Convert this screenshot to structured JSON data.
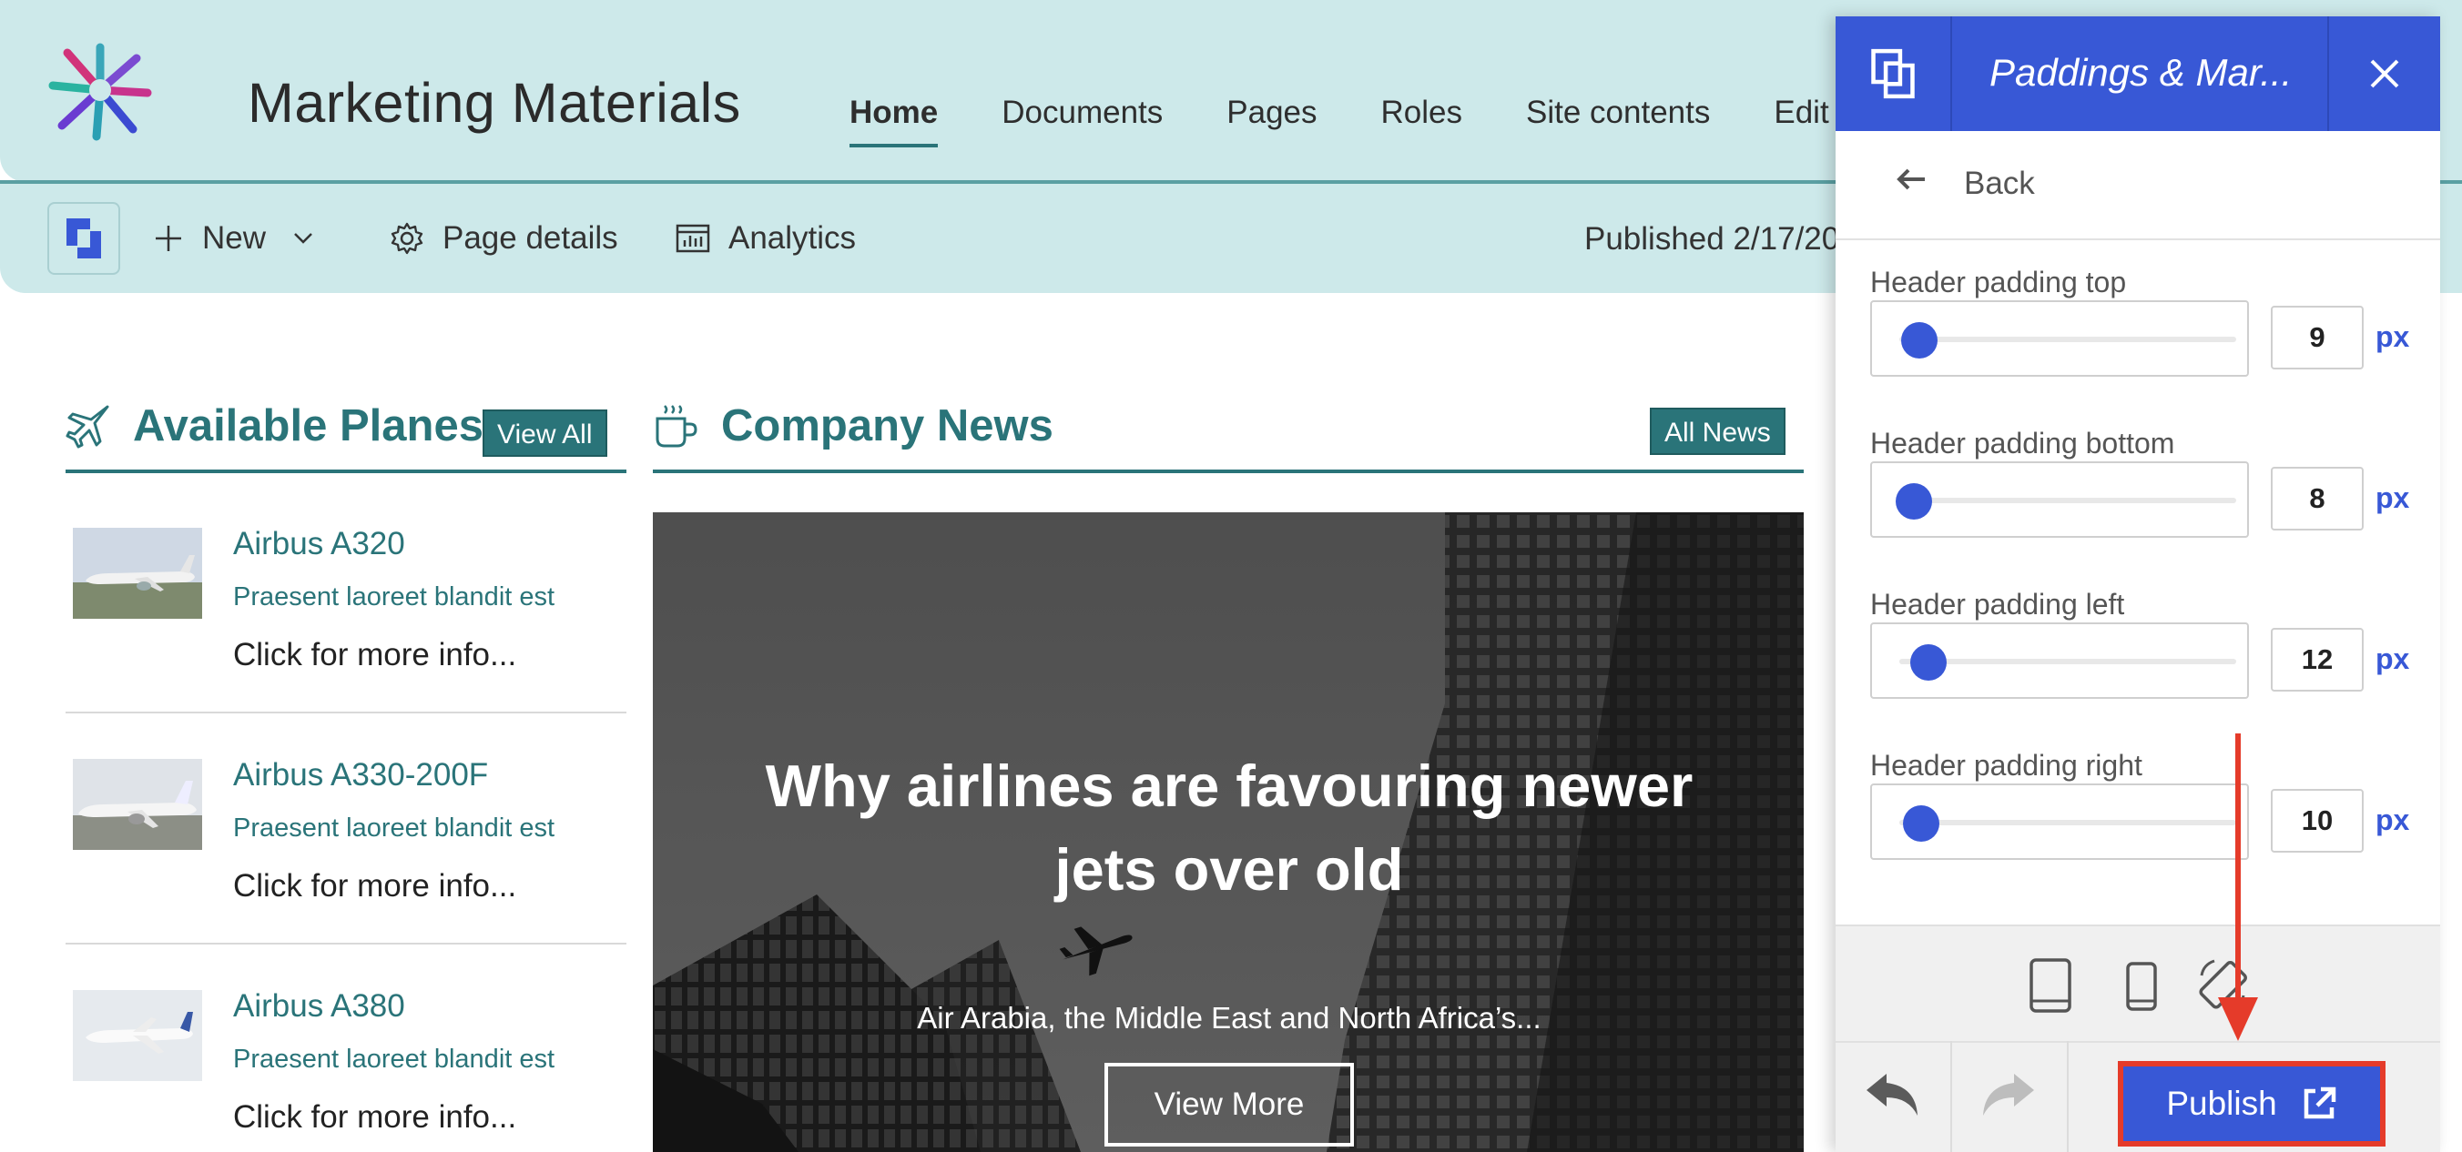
{
  "site": {
    "title": "Marketing Materials",
    "nav": [
      "Home",
      "Documents",
      "Pages",
      "Roles",
      "Site contents",
      "Edit"
    ]
  },
  "command_bar": {
    "new_label": "New",
    "page_details_label": "Page details",
    "analytics_label": "Analytics",
    "published_text": "Published 2/17/20"
  },
  "planes": {
    "title": "Available Planes",
    "view_all": "View All",
    "items": [
      {
        "name": "Airbus A320",
        "desc": "Praesent laoreet blandit est",
        "more": "Click for more info..."
      },
      {
        "name": "Airbus A330-200F",
        "desc": "Praesent laoreet blandit est",
        "more": "Click for more info..."
      },
      {
        "name": "Airbus A380",
        "desc": "Praesent laoreet blandit est",
        "more": "Click for more info..."
      }
    ]
  },
  "news": {
    "title": "Company News",
    "all_news": "All News",
    "headline": "Why airlines are favouring newer jets over old",
    "subtitle": "Air Arabia, the Middle East and North Africa’s...",
    "view_more": "View More"
  },
  "panel": {
    "title": "Paddings & Mar...",
    "back_label": "Back",
    "settings": [
      {
        "label": "Header padding top",
        "value": "9",
        "unit": "px"
      },
      {
        "label": "Header padding bottom",
        "value": "8",
        "unit": "px"
      },
      {
        "label": "Header padding left",
        "value": "12",
        "unit": "px"
      },
      {
        "label": "Header padding right",
        "value": "10",
        "unit": "px"
      }
    ],
    "publish_label": "Publish"
  },
  "colors": {
    "header_bg": "#cde9ea",
    "theme_teal": "#2a7479",
    "panel_accent": "#3858d6",
    "highlight_red": "#e53b2a"
  }
}
